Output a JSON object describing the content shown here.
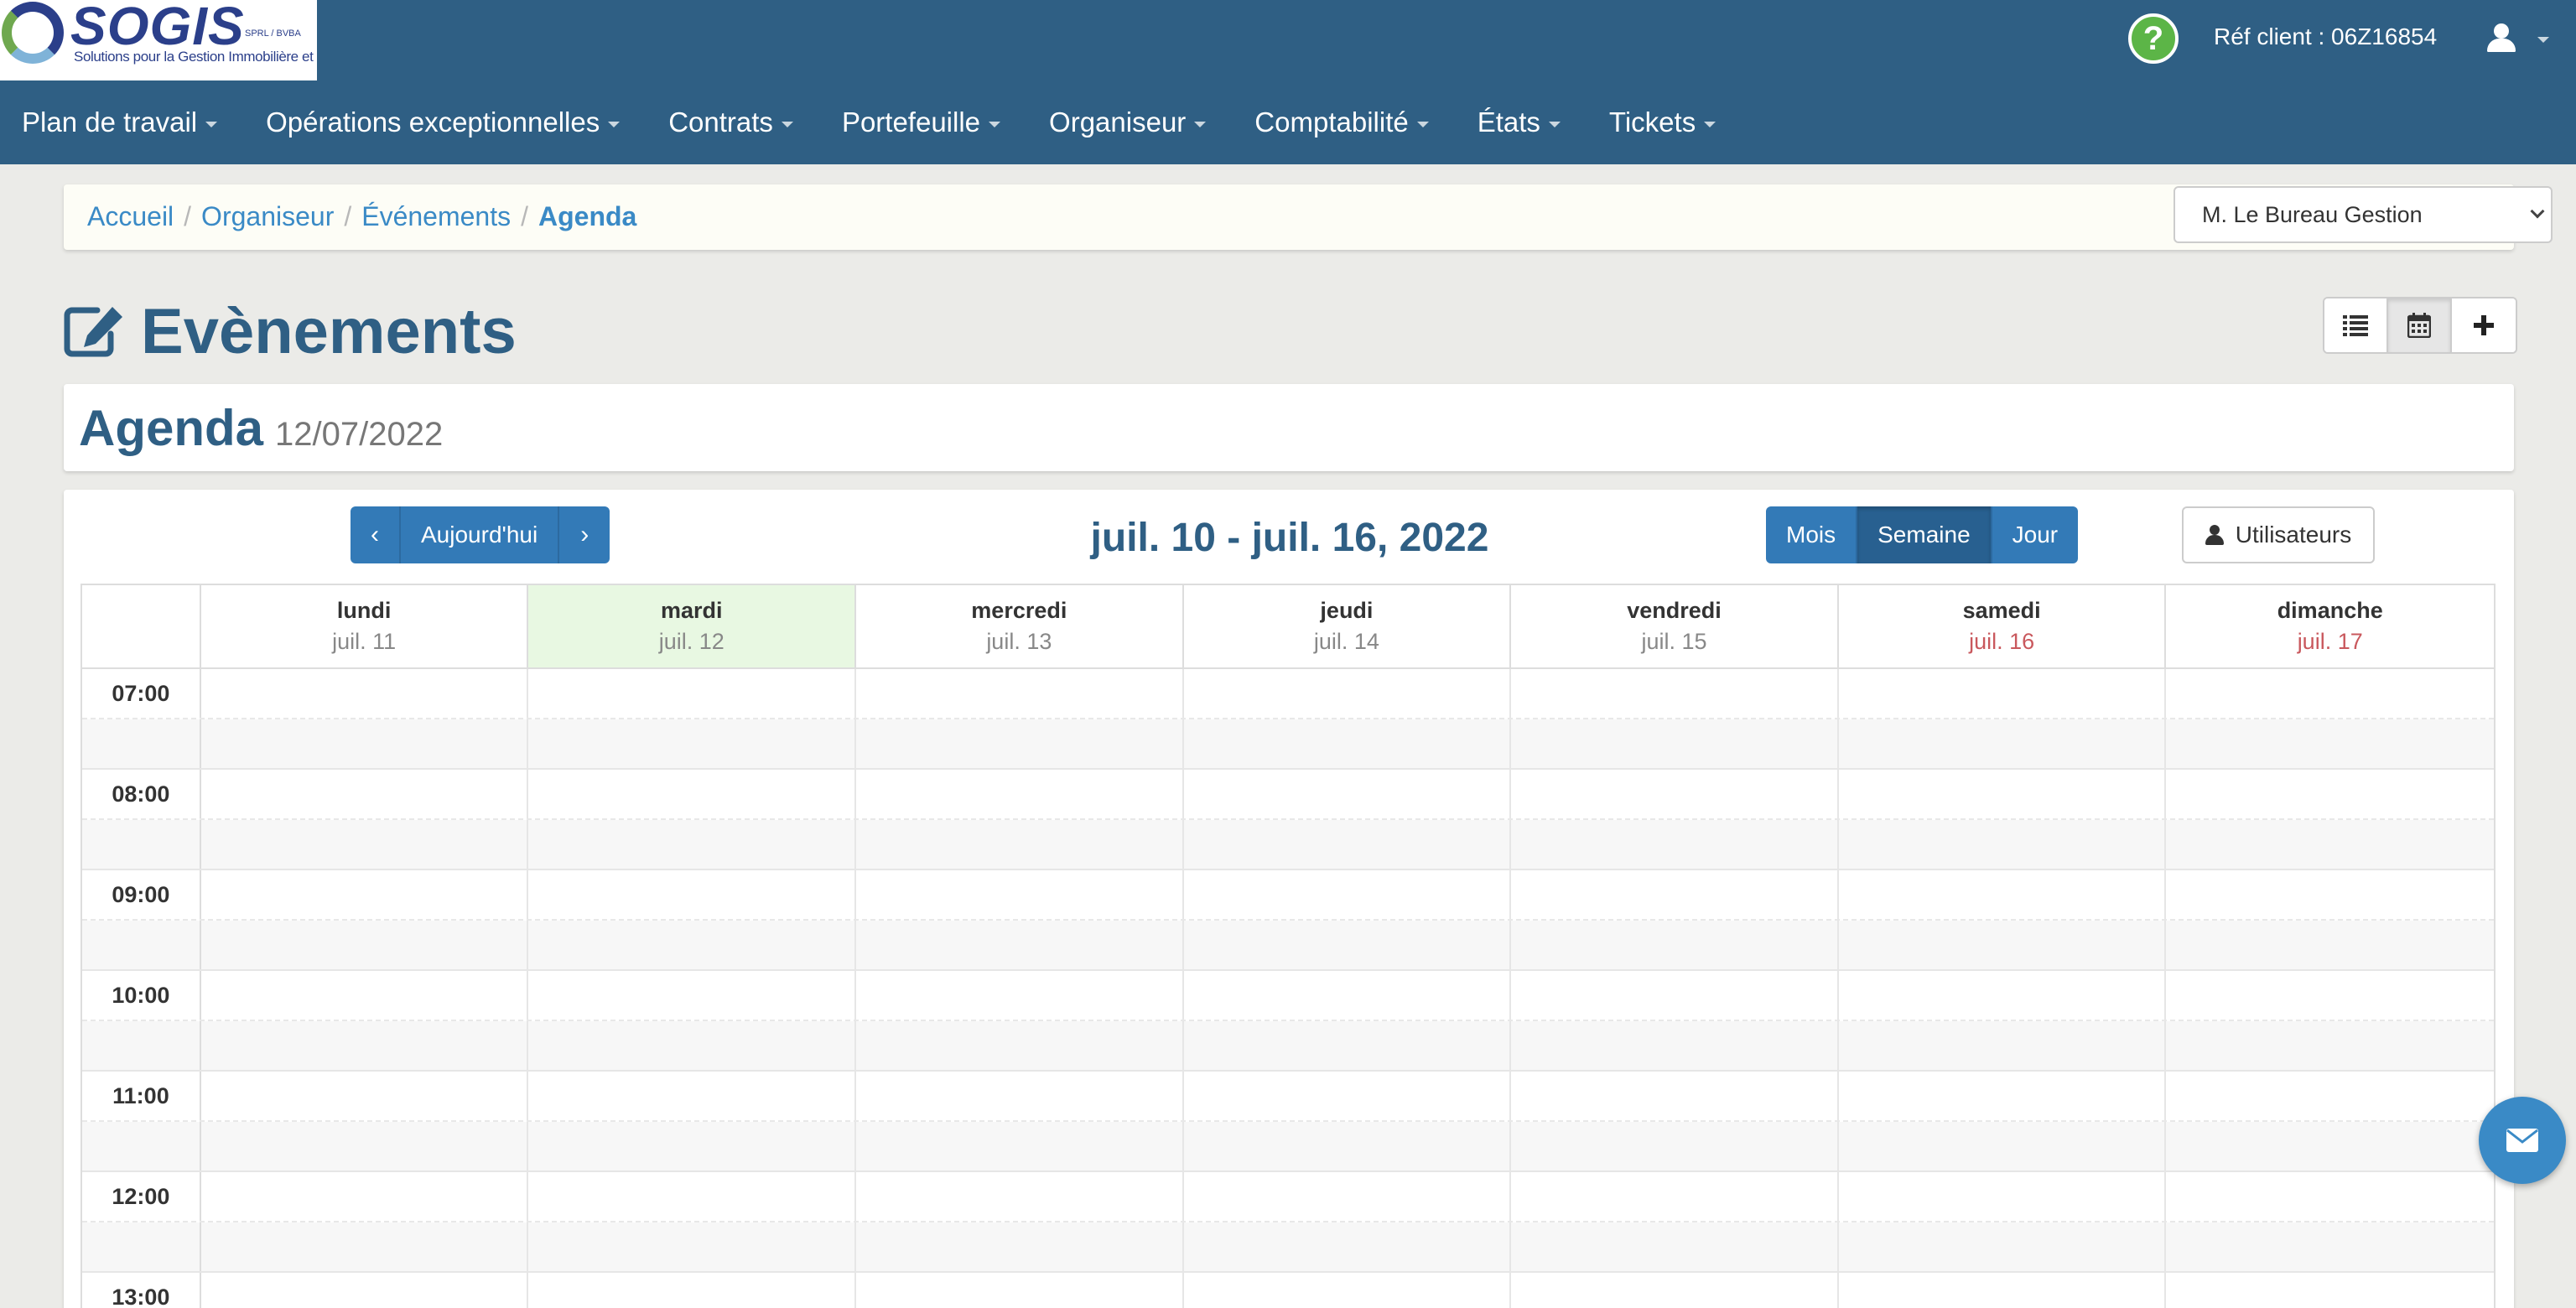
{
  "brand": {
    "logo_text": "SOGIS",
    "logo_small": "SPRL / BVBA",
    "logo_tagline": "Solutions pour la Gestion Immobilière et le Syndic"
  },
  "header": {
    "ref_client": "Réf client : 06Z16854",
    "help_icon": "question-circle-icon",
    "user_icon": "user-icon"
  },
  "nav": {
    "items": [
      {
        "label": "Plan de travail"
      },
      {
        "label": "Opérations exceptionnelles"
      },
      {
        "label": "Contrats"
      },
      {
        "label": "Portefeuille"
      },
      {
        "label": "Organiseur"
      },
      {
        "label": "Comptabilité"
      },
      {
        "label": "États"
      },
      {
        "label": "Tickets"
      }
    ]
  },
  "breadcrumb": {
    "items": [
      "Accueil",
      "Organiseur",
      "Événements"
    ],
    "active": "Agenda"
  },
  "bureau_select": {
    "selected": "M. Le Bureau Gestion"
  },
  "page": {
    "title": "Evènements",
    "title_icon": "edit-icon",
    "view_buttons": [
      "list-icon",
      "calendar-icon",
      "plus-icon"
    ],
    "active_view": "calendar-icon"
  },
  "agenda": {
    "title": "Agenda",
    "date": "12/07/2022"
  },
  "calendar": {
    "prev_label": "‹",
    "today_label": "Aujourd'hui",
    "next_label": "›",
    "range_title": "juil. 10 - juil. 16, 2022",
    "views": [
      "Mois",
      "Semaine",
      "Jour"
    ],
    "active_view": "Semaine",
    "users_label": "Utilisateurs",
    "days": [
      {
        "name": "lundi",
        "date": "juil. 11"
      },
      {
        "name": "mardi",
        "date": "juil. 12",
        "today": true
      },
      {
        "name": "mercredi",
        "date": "juil. 13"
      },
      {
        "name": "jeudi",
        "date": "juil. 14"
      },
      {
        "name": "vendredi",
        "date": "juil. 15"
      },
      {
        "name": "samedi",
        "date": "juil. 16",
        "weekend": true
      },
      {
        "name": "dimanche",
        "date": "juil. 17",
        "weekend": true
      }
    ],
    "hours": [
      "07:00",
      "08:00",
      "09:00",
      "10:00",
      "11:00",
      "12:00",
      "13:00"
    ],
    "weekend_color": "#c9585d",
    "today_color": "#e8f8e2"
  },
  "colors": {
    "primary": "#2f5f84",
    "button_blue": "#337ab7",
    "link": "#3a8ac6",
    "help_green": "#5cb547"
  },
  "fab": {
    "icon": "envelope-icon"
  }
}
